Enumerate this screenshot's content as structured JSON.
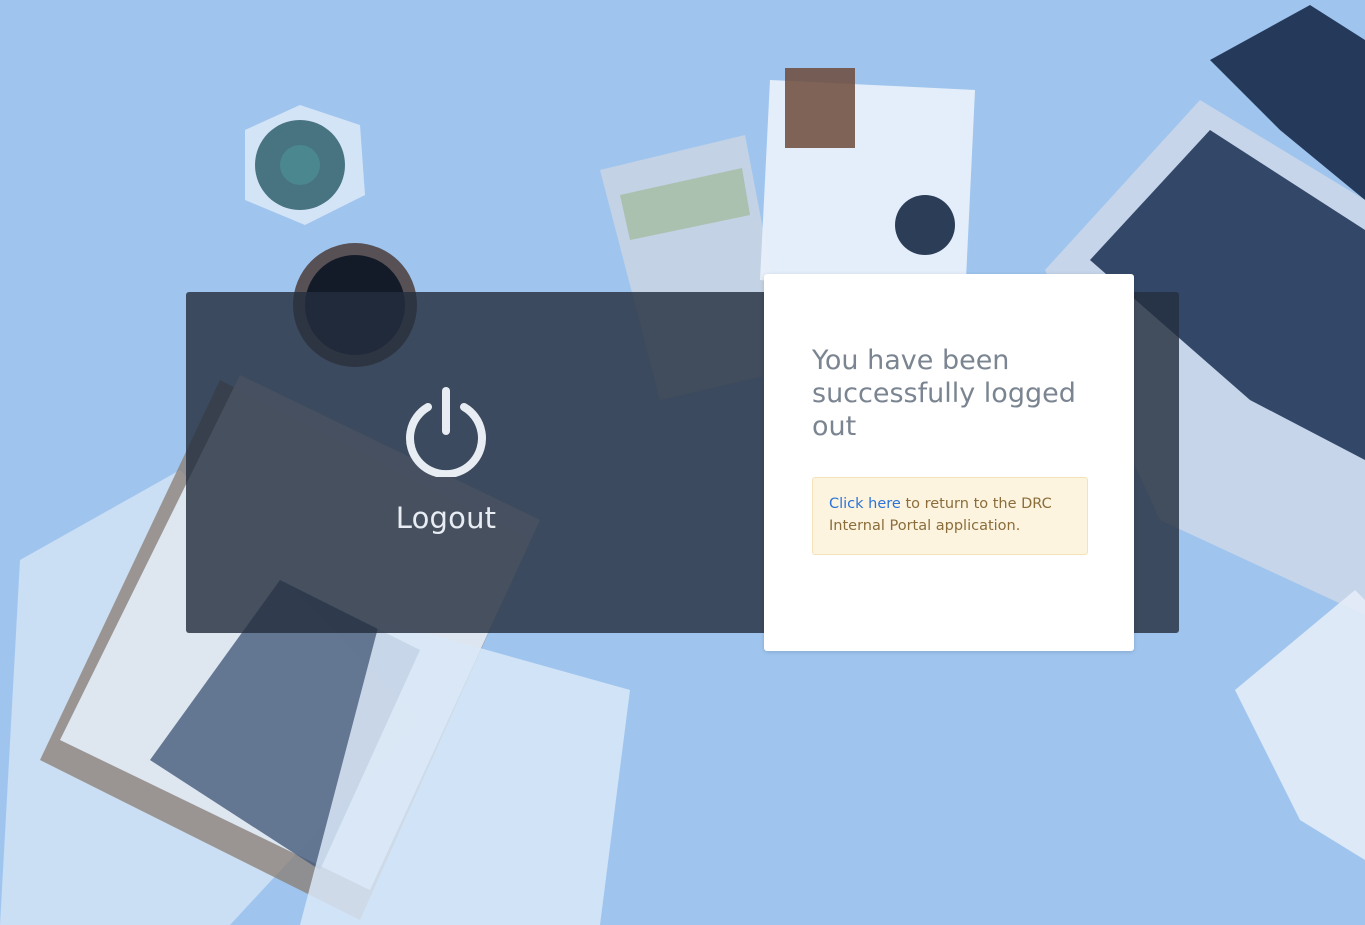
{
  "logout": {
    "icon": "power-icon",
    "label": "Logout"
  },
  "card": {
    "title": "You have been successfully logged out",
    "notice": {
      "link_text": "Click here",
      "rest_text": " to return to the DRC Internal Portal application."
    }
  },
  "colors": {
    "background": "#9fc5ef",
    "overlay": "#242e3e",
    "card": "#ffffff",
    "notice_bg": "#fdf4df",
    "notice_text": "#8a6d3b",
    "link": "#2a73d9"
  }
}
